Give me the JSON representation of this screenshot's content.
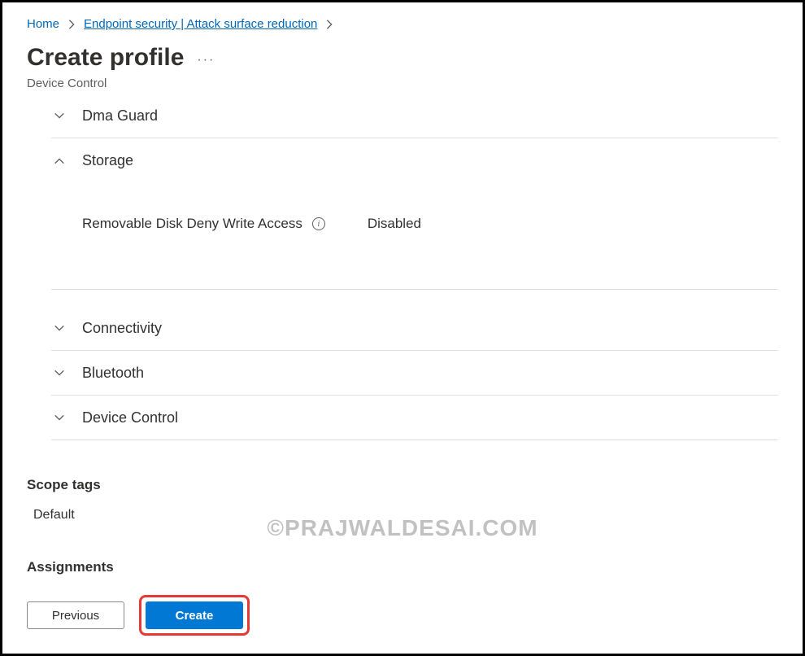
{
  "breadcrumb": {
    "home": "Home",
    "link": "Endpoint security | Attack surface reduction"
  },
  "page": {
    "title": "Create profile",
    "subtitle": "Device Control"
  },
  "sections": {
    "dma_guard": {
      "label": "Dma Guard"
    },
    "storage": {
      "label": "Storage",
      "setting_label": "Removable Disk Deny Write Access",
      "setting_value": "Disabled"
    },
    "connectivity": {
      "label": "Connectivity"
    },
    "bluetooth": {
      "label": "Bluetooth"
    },
    "device_control": {
      "label": "Device Control"
    }
  },
  "scope_tags": {
    "heading": "Scope tags",
    "value": "Default"
  },
  "assignments": {
    "heading": "Assignments"
  },
  "footer": {
    "previous": "Previous",
    "create": "Create"
  },
  "watermark": "©PRAJWALDESAI.COM"
}
